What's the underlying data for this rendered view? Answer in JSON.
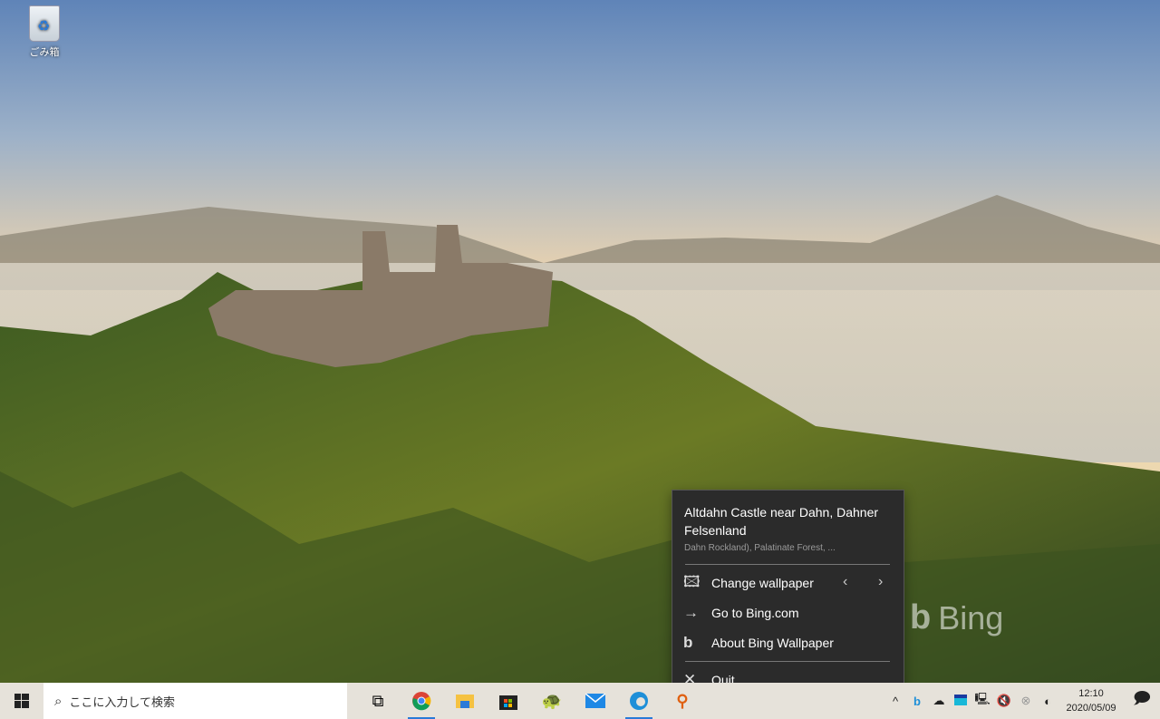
{
  "desktop": {
    "recycle_bin_label": "ごみ箱",
    "watermark": "Bing"
  },
  "popup": {
    "title": "Altdahn Castle near Dahn, Dahner Felsenland",
    "subtitle": "Dahn Rockland), Palatinate Forest, ...",
    "items": [
      {
        "label": "Change wallpaper",
        "icon": "image-icon"
      },
      {
        "label": "Go to Bing.com",
        "icon": "arrow-right-icon"
      },
      {
        "label": "About Bing Wallpaper",
        "icon": "bing-icon"
      },
      {
        "label": "Quit",
        "icon": "close-icon"
      }
    ],
    "prev": "‹",
    "next": "›"
  },
  "taskbar": {
    "search_placeholder": "ここに入力して検索",
    "apps": [
      "task-view",
      "chrome",
      "file-explorer",
      "microsoft-store",
      "turtle-app",
      "mail",
      "edge",
      "search-app"
    ],
    "clock_time": "12:10",
    "clock_date": "2020/05/09"
  },
  "colors": {
    "menu_bg": "#2b2b2b",
    "taskbar_bg": "#e6e2da",
    "accent": "#2a7ad8"
  }
}
